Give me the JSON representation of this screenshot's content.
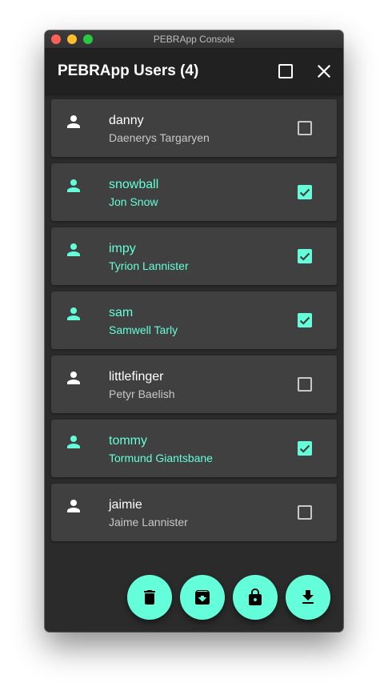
{
  "window": {
    "title": "PEBRApp Console"
  },
  "appbar": {
    "title": "PEBRApp Users (4)"
  },
  "colors": {
    "accent": "#64ffda",
    "card_background": "#404040",
    "window_background": "#2b2b2b",
    "appbar_background": "#212121"
  },
  "users": [
    {
      "username": "danny",
      "full_name": "Daenerys Targaryen",
      "selected": false
    },
    {
      "username": "snowball",
      "full_name": "Jon Snow",
      "selected": true
    },
    {
      "username": "impy",
      "full_name": "Tyrion Lannister",
      "selected": true
    },
    {
      "username": "sam",
      "full_name": "Samwell Tarly",
      "selected": true
    },
    {
      "username": "littlefinger",
      "full_name": "Petyr Baelish",
      "selected": false
    },
    {
      "username": "tommy",
      "full_name": "Tormund Giantsbane",
      "selected": true
    },
    {
      "username": "jaimie",
      "full_name": "Jaime Lannister",
      "selected": false
    }
  ],
  "actions": [
    {
      "name": "delete",
      "icon": "delete-icon"
    },
    {
      "name": "archive",
      "icon": "archive-icon"
    },
    {
      "name": "lock",
      "icon": "lock-icon"
    },
    {
      "name": "download",
      "icon": "download-icon"
    }
  ]
}
